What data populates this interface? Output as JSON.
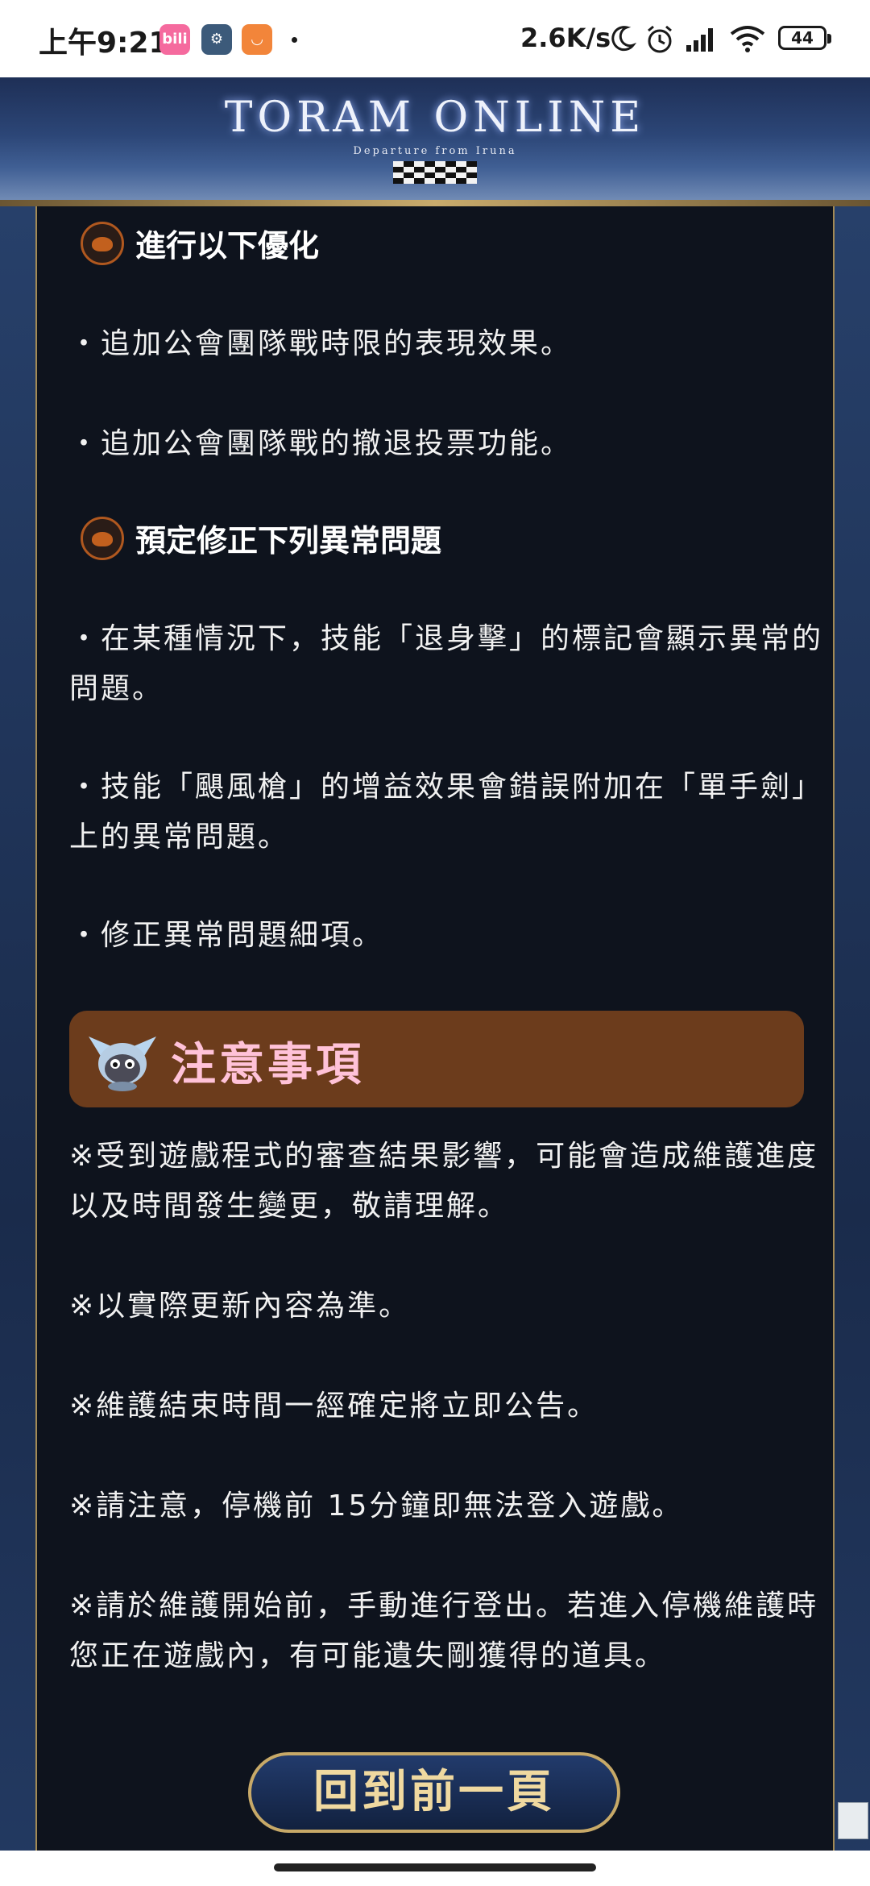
{
  "status_bar": {
    "time": "上午9:21",
    "net_speed": "2.6K/s",
    "battery": "44",
    "apps": [
      {
        "icon": "bilibili-app-icon",
        "label": "bili"
      },
      {
        "icon": "settings-app-icon",
        "label": "⚙"
      },
      {
        "icon": "shopping-bag-app-icon",
        "label": "◡"
      }
    ]
  },
  "banner": {
    "title": "TORAM ONLINE",
    "subtitle": "Departure from Iruna"
  },
  "sections": [
    {
      "heading": "進行以下優化",
      "items": [
        "・追加公會團隊戰時限的表現效果。",
        "・追加公會團隊戰的撤退投票功能。"
      ]
    },
    {
      "heading": "預定修正下列異常問題",
      "items": [
        "・在某種情況下，技能「退身擊」的標記會顯示異常的問題。",
        "・技能「颶風槍」的增益效果會錯誤附加在「單手劍」上的異常問題。",
        "・修正異常問題細項。"
      ]
    }
  ],
  "notice": {
    "title": "注意事項",
    "items": [
      "※受到遊戲程式的審查結果影響，可能會造成維護進度以及時間發生變更，敬請理解。",
      "※以實際更新內容為準。",
      "※維護結束時間一經確定將立即公告。",
      "※請注意，停機前 15分鐘即無法登入遊戲。",
      "※請於維護開始前，手動進行登出。若進入停機維護時您正在遊戲內，有可能遺失剛獲得的道具。"
    ]
  },
  "back_button": "回到前一頁",
  "colors": {
    "panel_bg": "#0e131d",
    "notice_bg": "#6c3c1c",
    "notice_title": "#ffc2d8",
    "gold_border": "#c7a968"
  }
}
